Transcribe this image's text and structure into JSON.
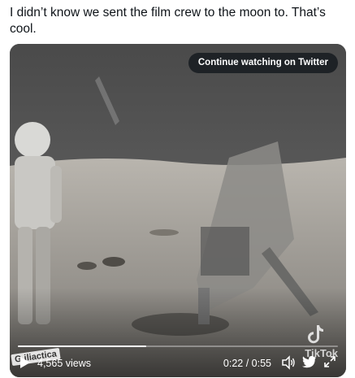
{
  "tweet": {
    "text": "I didn’t know we sent the film crew to the moon to. That’s cool."
  },
  "video": {
    "continue_label": "Continue watching on Twitter",
    "views": "4,565 views",
    "time": "0:22 / 0:55",
    "progress": 0.4,
    "watermark": "TikTok",
    "channel_stamp": "G iliactica"
  },
  "icons": {
    "play": "play-icon",
    "volume": "volume-icon",
    "twitter": "twitter-bird-icon",
    "fullscreen": "fullscreen-icon",
    "tiktok": "tiktok-icon"
  }
}
